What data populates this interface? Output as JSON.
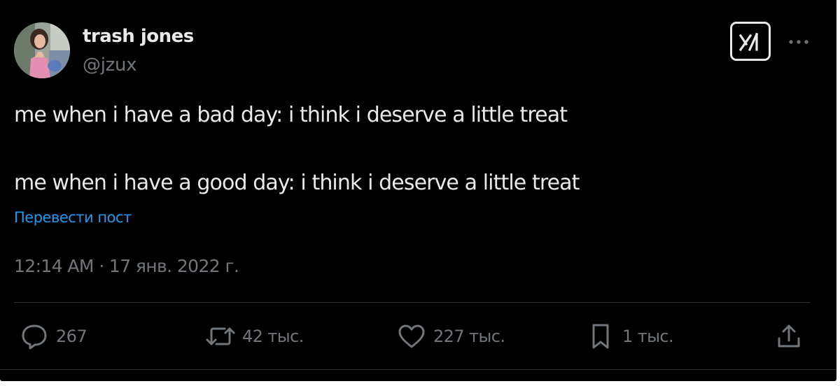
{
  "author": {
    "display_name": "trash jones",
    "handle": "@jzux"
  },
  "header_icons": {
    "grok": "grok-icon",
    "more": "more-dots-icon"
  },
  "tweet": {
    "line1": "me when i have a bad day: i think i deserve a little treat",
    "line2": "me when i have a good day: i think i deserve a little treat",
    "translate_label": "Перевести пост",
    "timestamp": "12:14 AM · 17 янв. 2022 г."
  },
  "actions": {
    "reply": {
      "icon": "reply-bubble-icon",
      "count": "267"
    },
    "repost": {
      "icon": "repost-icon",
      "count": "42 тыс."
    },
    "like": {
      "icon": "heart-icon",
      "count": "227 тыс."
    },
    "bookmark": {
      "icon": "bookmark-icon",
      "count": "1 тыс."
    },
    "share": {
      "icon": "share-icon"
    }
  },
  "colors": {
    "background": "#000000",
    "text_primary": "#e7e9ea",
    "text_secondary": "#71767b",
    "link": "#1d9bf0",
    "divider": "#2f3336"
  }
}
